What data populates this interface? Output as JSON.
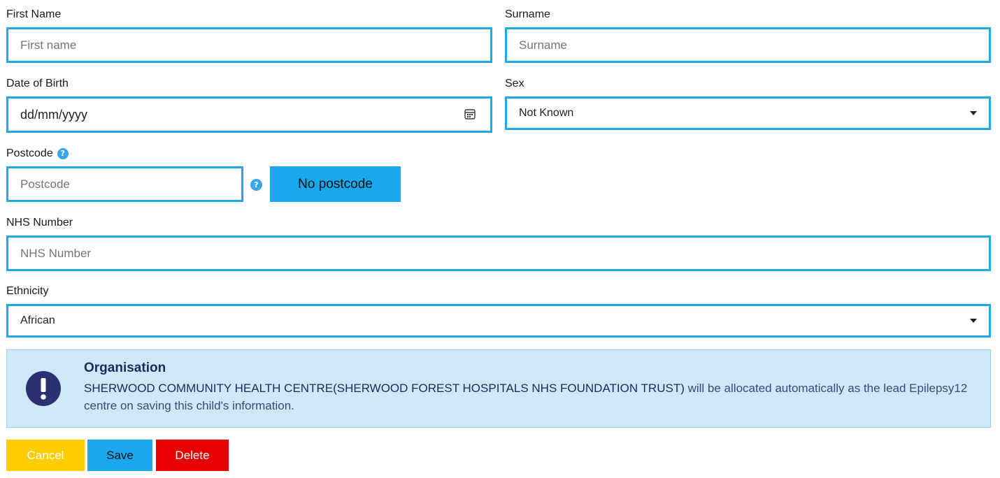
{
  "form": {
    "first_name": {
      "label": "First Name",
      "placeholder": "First name",
      "value": ""
    },
    "surname": {
      "label": "Surname",
      "placeholder": "Surname",
      "value": ""
    },
    "dob": {
      "label": "Date of Birth",
      "value": "dd/mm/yyyy",
      "icon": "calendar-icon"
    },
    "sex": {
      "label": "Sex",
      "value": "Not Known"
    },
    "postcode": {
      "label": "Postcode",
      "placeholder": "Postcode",
      "help_icon": "question-circle-icon",
      "no_postcode_label": "No postcode"
    },
    "nhs_number": {
      "label": "NHS Number",
      "placeholder": "NHS Number"
    },
    "ethnicity": {
      "label": "Ethnicity",
      "value": "African"
    }
  },
  "organisation": {
    "title": "Organisation",
    "org_name": "SHERWOOD COMMUNITY HEALTH CENTRE(SHERWOOD FOREST HOSPITALS NHS FOUNDATION TRUST)",
    "message": " will be allocated automatically as the lead Epilepsy12 centre on saving this child's information.",
    "icon": "exclamation-circle-icon"
  },
  "actions": {
    "cancel_label": "Cancel",
    "save_label": "Save",
    "delete_label": "Delete"
  },
  "colors": {
    "field_border": "#1fa8e6",
    "info_bg": "#cfe8f9",
    "cancel": "#ffcc00",
    "save": "#19a7ee",
    "delete": "#e60000",
    "alert_icon": "#2b3170"
  }
}
